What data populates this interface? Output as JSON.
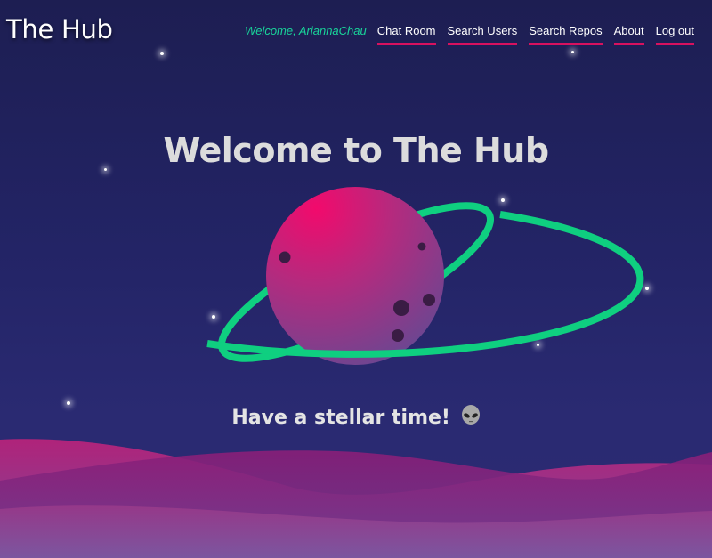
{
  "header": {
    "brand": "The Hub",
    "welcome": "Welcome, AriannaChau",
    "nav": [
      {
        "label": "Chat Room"
      },
      {
        "label": "Search Users"
      },
      {
        "label": "Search Repos"
      },
      {
        "label": "About"
      },
      {
        "label": "Log out"
      }
    ]
  },
  "hero": {
    "title": "Welcome to The Hub",
    "tagline": "Have a stellar time!",
    "tagline_icon": "alien-icon"
  },
  "colors": {
    "background": "#232466",
    "accent_pink": "#d8115f",
    "accent_green": "#19d49a",
    "planet_ring": "#0fcf80"
  }
}
